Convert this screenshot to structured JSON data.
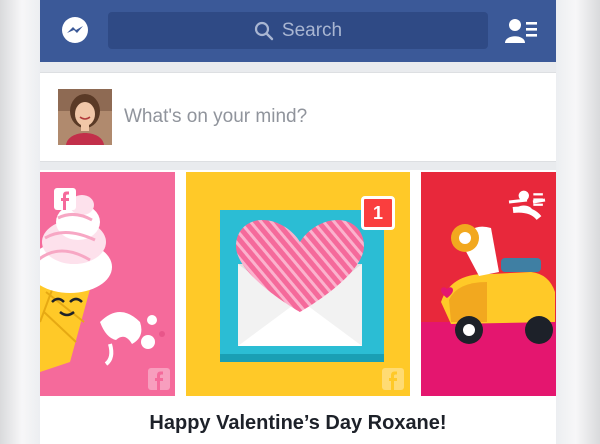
{
  "search": {
    "placeholder": "Search"
  },
  "composer": {
    "prompt": "What's on your mind?"
  },
  "card": {
    "notification_count": "1",
    "caption": "Happy Valentine’s Day Roxane!"
  },
  "colors": {
    "brand_blue": "#3b5998",
    "search_bg": "#2f4a85",
    "badge_red": "#fa3e3e",
    "panel_pink": "#f56a9b",
    "panel_yellow": "#ffc928",
    "panel_red": "#e8283b",
    "frame_cyan": "#2bbdd4"
  },
  "icons": {
    "messenger": "messenger-icon",
    "search": "search-icon",
    "friends": "friend-requests-icon",
    "facebook": "facebook-logo-icon",
    "heart": "heart-icon"
  }
}
